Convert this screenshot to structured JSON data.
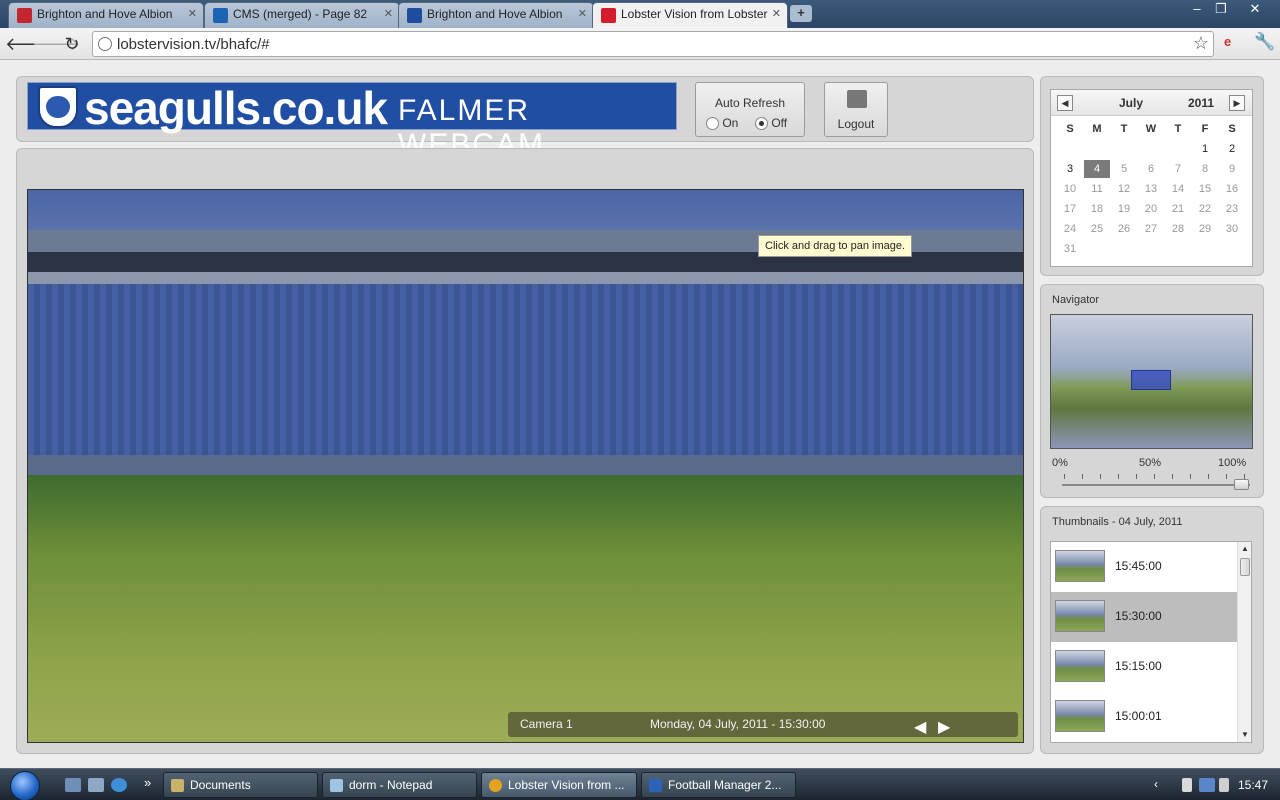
{
  "browser": {
    "tabs": [
      {
        "title": "Brighton and Hove Albion",
        "favicon_color": "#c4262e"
      },
      {
        "title": "CMS (merged) - Page 82",
        "favicon_color": "#1d63b3"
      },
      {
        "title": "Brighton and Hove Albion",
        "favicon_color": "#1d4d9c"
      },
      {
        "title": "Lobster Vision from Lobster",
        "favicon_color": "#d51c2a"
      }
    ],
    "new_tab": "+",
    "url": "lobstervision.tv/bhafc/#"
  },
  "header": {
    "logo_main": "seagulls.co.uk",
    "logo_sub": "FALMER WEBCAM",
    "auto_refresh": {
      "label": "Auto Refresh",
      "on_label": "On",
      "off_label": "Off",
      "selected": "Off"
    },
    "logout_label": "Logout"
  },
  "viewer": {
    "tooltip": "Click and drag to pan image.",
    "camera": "Camera 1",
    "timestamp": "Monday, 04 July, 2011 - 15:30:00"
  },
  "calendar": {
    "month": "July",
    "year": "2011",
    "weekdays": [
      "S",
      "M",
      "T",
      "W",
      "T",
      "F",
      "S"
    ],
    "first_weekday_index": 5,
    "days_in_month": 31,
    "selected_day": 4,
    "active_through_day": 4
  },
  "navigator": {
    "title": "Navigator",
    "zoom_labels": [
      "0%",
      "50%",
      "100%"
    ],
    "zoom_level": 1.0
  },
  "thumbnails": {
    "title": "Thumbnails - 04 July, 2011",
    "items": [
      {
        "time": "15:45:00",
        "selected": false
      },
      {
        "time": "15:30:00",
        "selected": true
      },
      {
        "time": "15:15:00",
        "selected": false
      },
      {
        "time": "15:00:01",
        "selected": false
      }
    ]
  },
  "taskbar": {
    "tasks": [
      {
        "label": "Documents",
        "icon_color": "#c9b36a"
      },
      {
        "label": "dorm - Notepad",
        "icon_color": "#9fc4e6"
      },
      {
        "label": "Lobster Vision from ...",
        "icon_color": "#e2a322"
      },
      {
        "label": "Football Manager 2...",
        "icon_color": "#2a63b7"
      }
    ],
    "clock": "15:47"
  }
}
